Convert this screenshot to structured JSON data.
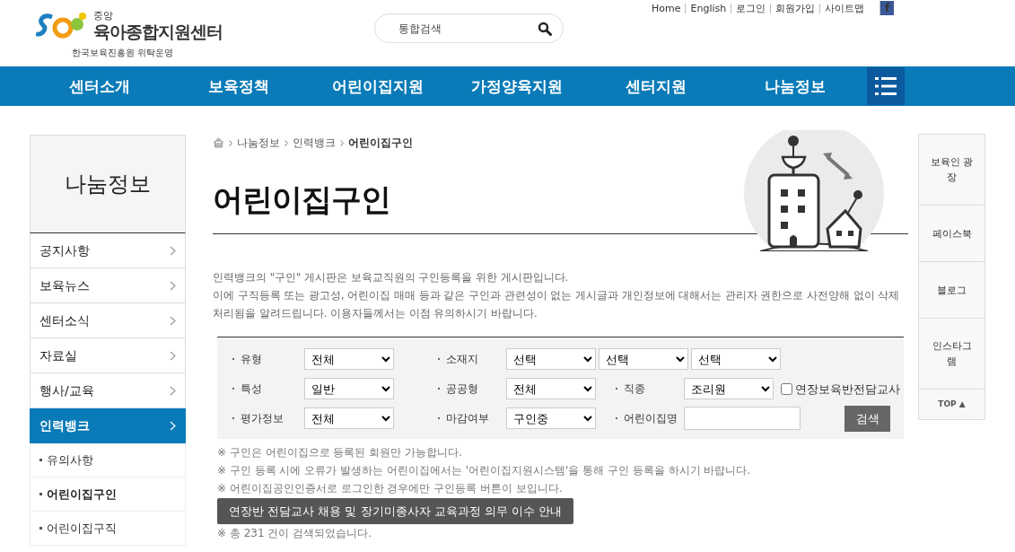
{
  "utility_links": [
    "Home",
    "English",
    "로그인",
    "회원가입",
    "사이트맵"
  ],
  "facebook_icon": "f",
  "logo": {
    "small": "중앙",
    "name": "육아종합지원센터",
    "sub": "한국보육진흥원 위탁운영"
  },
  "search": {
    "placeholder": "통합검색"
  },
  "main_nav": [
    {
      "label": "센터소개",
      "selected": false
    },
    {
      "label": "보육정책",
      "selected": false
    },
    {
      "label": "어린이집지원",
      "selected": false
    },
    {
      "label": "가정양육지원",
      "selected": false
    },
    {
      "label": "센터지원",
      "selected": false
    },
    {
      "label": "나눔정보",
      "selected": false
    }
  ],
  "sidebar": {
    "title": "나눔정보",
    "items": [
      {
        "label": "공지사항",
        "selected": false
      },
      {
        "label": "보육뉴스",
        "selected": false
      },
      {
        "label": "센터소식",
        "selected": false
      },
      {
        "label": "자료실",
        "selected": false
      },
      {
        "label": "행사/교육",
        "selected": false
      },
      {
        "label": "인력뱅크",
        "selected": true,
        "children": [
          {
            "label": "유의사항",
            "selected": false
          },
          {
            "label": "어린이집구인",
            "selected": true
          },
          {
            "label": "어린이집구직",
            "selected": false
          }
        ]
      }
    ]
  },
  "breadcrumb": [
    "나눔정보",
    "인력뱅크",
    "어린이집구인"
  ],
  "page_title": "어린이집구인",
  "intro": [
    "인력뱅크의 \"구인\" 게시판은 보육교직원의 구인등록을 위한 게시판입니다.",
    "이에 구직등록 또는 광고성, 어린이집 매매 등과 같은 구인과 관련성이 없는 게시글과 개인정보에 대해서는 관리자 권한으로 사전양해 없이 삭제 처리됨을 알려드립니다. 이용자들께서는 이점 유의하시기 바랍니다."
  ],
  "filters": [
    [
      {
        "kind": "select",
        "label": "유형",
        "values": [
          "전체"
        ]
      },
      {
        "kind": "select",
        "label": "소재지",
        "values": [
          "선택",
          "선택",
          "선택"
        ]
      }
    ],
    [
      {
        "kind": "select",
        "label": "특성",
        "values": [
          "일반"
        ]
      },
      {
        "kind": "select",
        "label": "공공형",
        "values": [
          "전체"
        ]
      },
      {
        "kind": "select",
        "label": "직종",
        "values": [
          "조리원"
        ]
      },
      {
        "kind": "checkbox",
        "label": "연장보육반전담교사",
        "checked": false
      }
    ],
    [
      {
        "kind": "select",
        "label": "평가정보",
        "values": [
          "전체"
        ]
      },
      {
        "kind": "select",
        "label": "마감여부",
        "values": [
          "구인중"
        ]
      },
      {
        "kind": "text",
        "label": "어린이집명"
      },
      {
        "kind": "button",
        "label": "검색"
      }
    ]
  ],
  "notes": [
    "※ 구인은 어린이집으로 등록된 회원만 가능합니다.",
    "※ 구인 등록 시에 오류가 발생하는 어린이집에서는 '어린이집지원시스템'을 통해 구인 등록을 하시기 바랍니다.",
    "※ 어린이집공인인증서로 로그인한 경우에만 구인등록 버튼이 보입니다."
  ],
  "notice_button": "연장반 전담교사 채용 및 장기미종사자 교육과정 의무 이수 안내",
  "result_count": "※ 총 231 건이 검색되었습니다.",
  "quick_menu": [
    "보육인 광장",
    "페이스북",
    "블로그",
    "인스타그램"
  ],
  "top_button": "TOP ▲"
}
